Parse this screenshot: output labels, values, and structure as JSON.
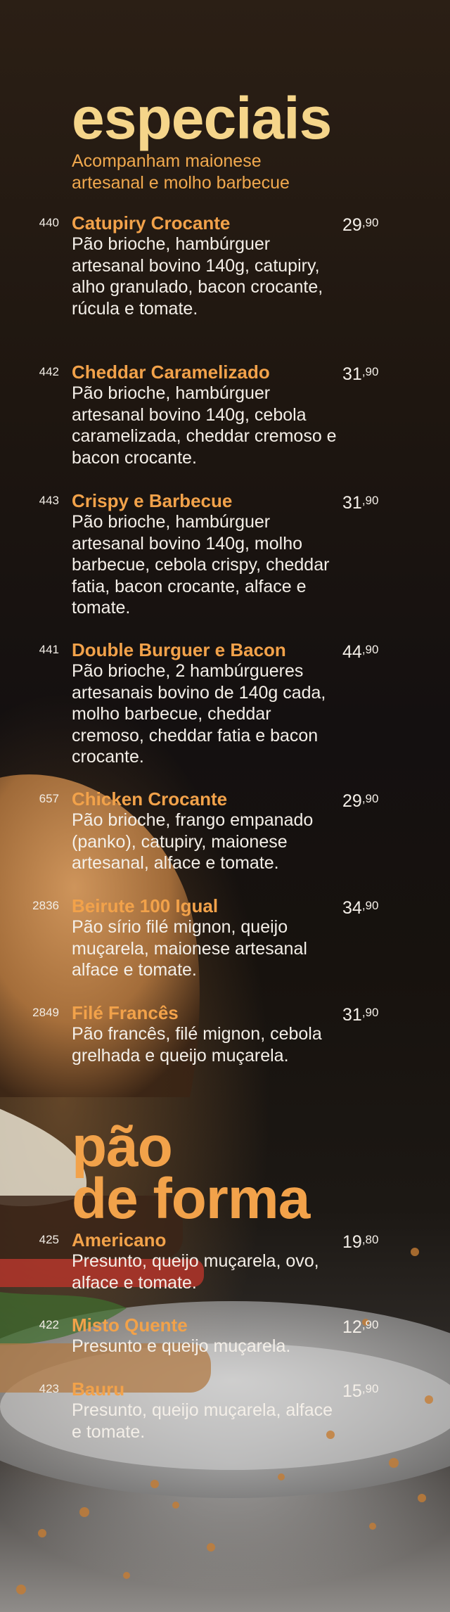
{
  "sections": [
    {
      "title": "especiais",
      "subtitle": "Acompanham maionese artesanal e molho barbecue",
      "items": [
        {
          "code": "440",
          "name": "Catupiry Crocante",
          "desc": "Pão brioche, hambúrguer artesanal bovino 140g, catupiry, alho granulado, bacon crocante, rúcula e tomate.",
          "price_int": "29",
          "price_cents": ",90"
        },
        {
          "code": "442",
          "name": "Cheddar Caramelizado",
          "desc": "Pão brioche, hambúrguer artesanal bovino 140g, cebola caramelizada, cheddar cremoso e bacon crocante.",
          "price_int": "31",
          "price_cents": ",90"
        },
        {
          "code": "443",
          "name": "Crispy e Barbecue",
          "desc": "Pão brioche, hambúrguer artesanal bovino 140g, molho barbecue, cebola crispy, cheddar fatia, bacon crocante, alface e tomate.",
          "price_int": "31",
          "price_cents": ",90"
        },
        {
          "code": "441",
          "name": "Double Burguer e Bacon",
          "desc": "Pão brioche, 2 hambúrgueres artesanais bovino de 140g cada, molho barbecue, cheddar cremoso, cheddar fatia e bacon crocante.",
          "price_int": "44",
          "price_cents": ",90"
        },
        {
          "code": "657",
          "name": "Chicken Crocante",
          "desc": "Pão brioche, frango empanado (panko), catupiry, maionese artesanal, alface e tomate.",
          "price_int": "29",
          "price_cents": ",90"
        },
        {
          "code": "2836",
          "name": "Beirute 100 Igual",
          "desc": "Pão sírio filé mignon, queijo muçarela, maionese artesanal alface e tomate.",
          "price_int": "34",
          "price_cents": ",90"
        },
        {
          "code": "2849",
          "name": "Filé Francês",
          "desc": "Pão francês, filé mignon, cebola grelhada e queijo muçarela.",
          "price_int": "31",
          "price_cents": ",90"
        }
      ]
    },
    {
      "title_line1": "pão",
      "title_line2": "de forma",
      "items": [
        {
          "code": "425",
          "name": "Americano",
          "desc": "Presunto, queijo muçarela, ovo, alface e tomate.",
          "price_int": "19",
          "price_cents": ",80"
        },
        {
          "code": "422",
          "name": "Misto Quente",
          "desc": "Presunto e queijo muçarela.",
          "price_int": "12",
          "price_cents": ",90"
        },
        {
          "code": "423",
          "name": "Bauru",
          "desc": "Presunto, queijo muçarela, alface e tomate.",
          "price_int": "15",
          "price_cents": ",90"
        }
      ]
    }
  ],
  "colors": {
    "title": "#f5d58a",
    "accent": "#f2a24a",
    "text": "#f4efe8"
  }
}
